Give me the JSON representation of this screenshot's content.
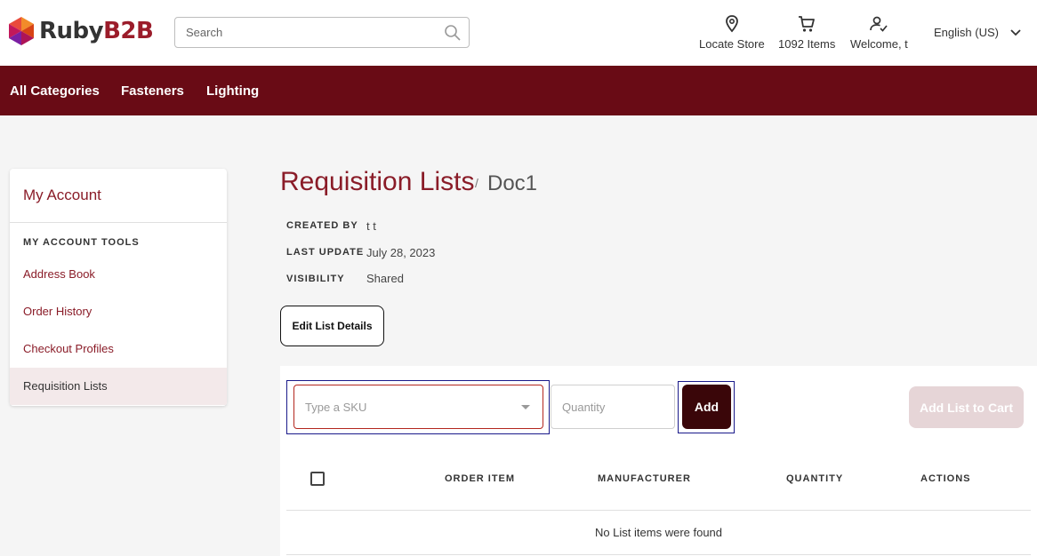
{
  "brand": {
    "name_part1": "Ruby",
    "name_part2": "B2B",
    "logo_icon": "hexagon-logo-icon"
  },
  "search": {
    "placeholder": "Search",
    "icon": "search-icon"
  },
  "header": {
    "locate_store": "Locate Store",
    "cart_count": "1092 Items",
    "welcome": "Welcome, t",
    "language": "English (US)"
  },
  "nav": {
    "items": [
      "All Categories",
      "Fasteners",
      "Lighting"
    ]
  },
  "sidebar": {
    "title": "My Account",
    "section": "MY ACCOUNT TOOLS",
    "items": [
      {
        "label": "Address Book",
        "active": false
      },
      {
        "label": "Order History",
        "active": false
      },
      {
        "label": "Checkout Profiles",
        "active": false
      },
      {
        "label": "Requisition Lists",
        "active": true
      }
    ]
  },
  "main": {
    "title": "Requisition Lists",
    "separator": "/",
    "doc_name": "Doc1",
    "meta": [
      {
        "label": "CREATED BY",
        "value": "t t"
      },
      {
        "label": "LAST UPDATE",
        "value": "July 28, 2023"
      },
      {
        "label": "VISIBILITY",
        "value": "Shared"
      }
    ],
    "edit_button": "Edit List Details"
  },
  "form": {
    "sku_placeholder": "Type a SKU",
    "quantity_placeholder": "Quantity",
    "add_button": "Add",
    "add_to_cart_button": "Add List to Cart"
  },
  "table": {
    "columns": [
      "ORDER ITEM",
      "MANUFACTURER",
      "QUANTITY",
      "ACTIONS"
    ],
    "empty_message": "No List items were found"
  },
  "colors": {
    "brand": "#9b1c2a",
    "nav_bg": "#690b15",
    "add_button_bg": "#3a0609",
    "disabled_button_bg": "#e6d5d7"
  }
}
